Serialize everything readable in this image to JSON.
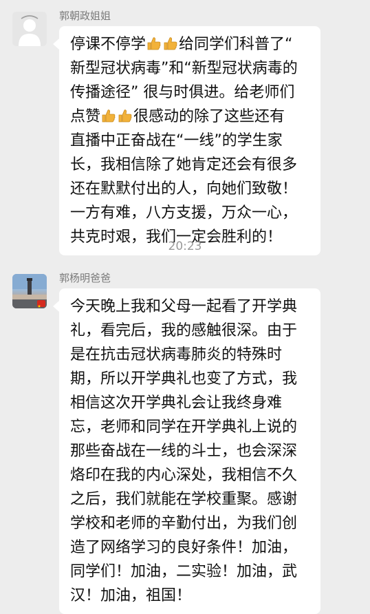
{
  "messages": [
    {
      "sender": "郭朝政姐姐",
      "lines": [
        [
          "停课不停学",
          "thumbs-up",
          "thumbs-up",
          "给同学们科普了“"
        ],
        [
          "新型冠状病毒”和“新型冠状病毒的"
        ],
        [
          "传播途径” 很与时俱进。给老师们"
        ],
        [
          "点赞",
          "thumbs-up",
          "thumbs-up",
          "很感动的除了这些还有"
        ],
        [
          "直播中正奋战在“一线”的学生家"
        ],
        [
          "长，我相信除了她肯定还会有很多"
        ],
        [
          "还在默默付出的人，向她们致敬！"
        ],
        [
          "一方有难，八方支援，万众一心，"
        ],
        [
          "共克时艰，我们一定会胜利的！"
        ]
      ]
    },
    {
      "sender": "郭杨明爸爸",
      "lines": [
        [
          "今天晚上我和父母一起看了开学典"
        ],
        [
          "礼，看完后，我的感触很深。由于"
        ],
        [
          "是在抗击冠状病毒肺炎的特殊时"
        ],
        [
          "期，所以开学典礼也变了方式，我"
        ],
        [
          "相信这次开学典礼会让我终身难"
        ],
        [
          "忘，老师和同学在开学典礼上说的"
        ],
        [
          "那些奋战在一线的斗士，也会深深"
        ],
        [
          "烙印在我的内心深处，我相信不久"
        ],
        [
          "之后，我们就能在学校重聚。感谢"
        ],
        [
          "学校和老师的辛勤付出，为我们创"
        ],
        [
          "造了网络学习的良好条件！加油，"
        ],
        [
          "同学们！加油，二实验！加油，武"
        ],
        [
          "汉！加油，祖国！"
        ]
      ]
    }
  ],
  "timestamp": "20:23",
  "colors": {
    "background": "#ededed",
    "bubble": "#ffffff",
    "sender_text": "#7a7a7a",
    "timestamp_text": "#9a9a9a",
    "thumb": "#f2b23a"
  }
}
